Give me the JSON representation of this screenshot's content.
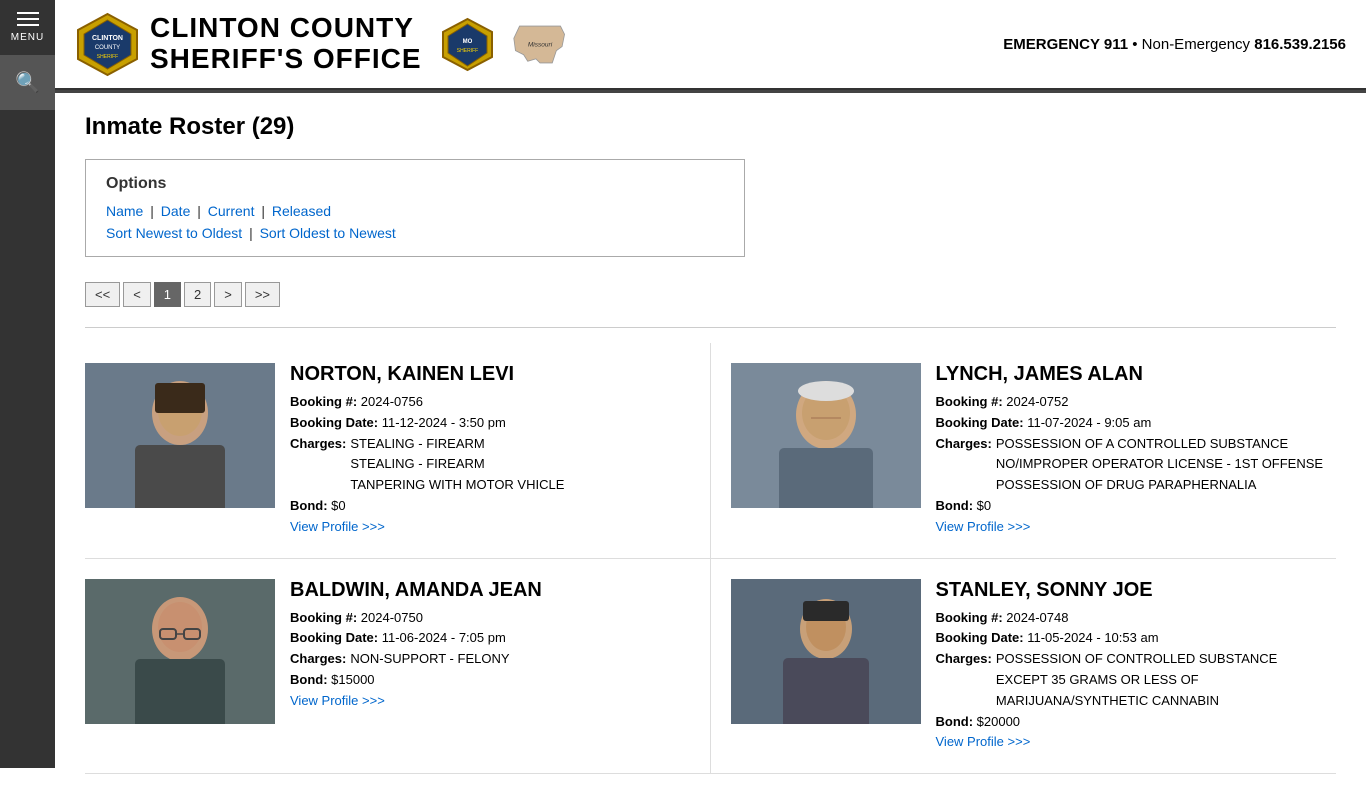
{
  "header": {
    "agency": "CLINTON COUNTY",
    "agency_sub": "SHERIFF'S OFFICE",
    "state": "Missouri",
    "emergency_label": "EMERGENCY 911",
    "non_emergency_label": "Non-Emergency",
    "non_emergency_number": "816.539.2156"
  },
  "sidebar": {
    "menu_label": "MENU"
  },
  "page": {
    "title": "Inmate Roster (29)"
  },
  "options": {
    "heading": "Options",
    "filter_links": [
      {
        "label": "Name",
        "href": "#"
      },
      {
        "label": "Date",
        "href": "#"
      },
      {
        "label": "Current",
        "href": "#"
      },
      {
        "label": "Released",
        "href": "#"
      }
    ],
    "sort_links": [
      {
        "label": "Sort Newest to Oldest",
        "href": "#"
      },
      {
        "label": "Sort Oldest to Newest",
        "href": "#"
      }
    ]
  },
  "pagination": {
    "buttons": [
      {
        "label": "<<",
        "active": false
      },
      {
        "label": "<",
        "active": false
      },
      {
        "label": "1",
        "active": true
      },
      {
        "label": "2",
        "active": false
      },
      {
        "label": ">",
        "active": false
      },
      {
        "label": ">>",
        "active": false
      }
    ]
  },
  "inmates": [
    {
      "id": "norton",
      "name": "NORTON, KAINEN LEVI",
      "booking_num_label": "Booking #:",
      "booking_num": "2024-0756",
      "booking_date_label": "Booking Date:",
      "booking_date": "11-12-2024 - 3:50 pm",
      "charges_label": "Charges:",
      "charges": [
        "STEALING - FIREARM",
        "STEALING - FIREARM",
        "TANPERING WITH MOTOR VHICLE"
      ],
      "bond_label": "Bond:",
      "bond": "$0",
      "view_profile_label": "View Profile >>>"
    },
    {
      "id": "lynch",
      "name": "LYNCH, JAMES ALAN",
      "booking_num_label": "Booking #:",
      "booking_num": "2024-0752",
      "booking_date_label": "Booking Date:",
      "booking_date": "11-07-2024 - 9:05 am",
      "charges_label": "Charges:",
      "charges": [
        "POSSESSION OF A CONTROLLED SUBSTANCE",
        "NO/IMPROPER OPERATOR LICENSE - 1ST OFFENSE",
        "POSSESSION OF DRUG PARAPHERNALIA"
      ],
      "bond_label": "Bond:",
      "bond": "$0",
      "view_profile_label": "View Profile >>>"
    },
    {
      "id": "baldwin",
      "name": "BALDWIN, AMANDA JEAN",
      "booking_num_label": "Booking #:",
      "booking_num": "2024-0750",
      "booking_date_label": "Booking Date:",
      "booking_date": "11-06-2024 - 7:05 pm",
      "charges_label": "Charges:",
      "charges": [
        "NON-SUPPORT - FELONY"
      ],
      "bond_label": "Bond:",
      "bond": "$15000",
      "view_profile_label": "View Profile >>>"
    },
    {
      "id": "stanley",
      "name": "STANLEY, SONNY JOE",
      "booking_num_label": "Booking #:",
      "booking_num": "2024-0748",
      "booking_date_label": "Booking Date:",
      "booking_date": "11-05-2024 - 10:53 am",
      "charges_label": "Charges:",
      "charges": [
        "POSSESSION OF CONTROLLED SUBSTANCE EXCEPT 35 GRAMS OR LESS OF MARIJUANA/SYNTHETIC CANNABIN"
      ],
      "bond_label": "Bond:",
      "bond": "$20000",
      "view_profile_label": "View Profile >>>"
    }
  ]
}
